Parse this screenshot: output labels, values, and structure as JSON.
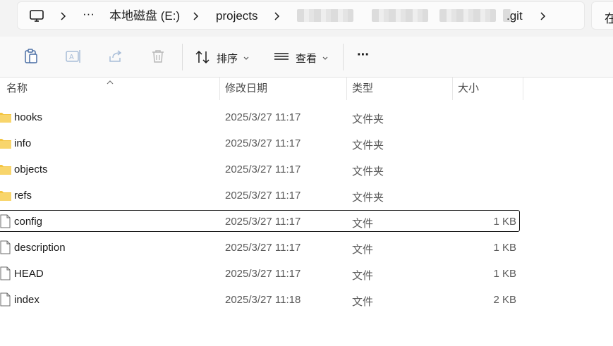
{
  "address_bar": {
    "drive": "本地磁盘 (E:)",
    "folder": "projects",
    "current": ".git",
    "more": "···"
  },
  "search_stub": "在",
  "toolbar": {
    "sort_label": "排序",
    "view_label": "查看",
    "more_label": "···"
  },
  "columns": {
    "name": "名称",
    "modified": "修改日期",
    "type": "类型",
    "size": "大小"
  },
  "files": [
    {
      "name": "hooks",
      "modified": "2025/3/27 11:17",
      "type": "文件夹",
      "size": "",
      "kind": "folder-icon"
    },
    {
      "name": "info",
      "modified": "2025/3/27 11:17",
      "type": "文件夹",
      "size": "",
      "kind": "folder-icon"
    },
    {
      "name": "objects",
      "modified": "2025/3/27 11:17",
      "type": "文件夹",
      "size": "",
      "kind": "folder-icon"
    },
    {
      "name": "refs",
      "modified": "2025/3/27 11:17",
      "type": "文件夹",
      "size": "",
      "kind": "folder-icon"
    },
    {
      "name": "config",
      "modified": "2025/3/27 11:17",
      "type": "文件",
      "size": "1 KB",
      "kind": "file-icon"
    },
    {
      "name": "description",
      "modified": "2025/3/27 11:17",
      "type": "文件",
      "size": "1 KB",
      "kind": "file-icon"
    },
    {
      "name": "HEAD",
      "modified": "2025/3/27 11:17",
      "type": "文件",
      "size": "1 KB",
      "kind": "file-icon"
    },
    {
      "name": "index",
      "modified": "2025/3/27 11:18",
      "type": "文件",
      "size": "2 KB",
      "kind": "file-icon"
    }
  ],
  "colors": {
    "folder": "#f4c542",
    "focus_border": "#1a1a1a"
  }
}
